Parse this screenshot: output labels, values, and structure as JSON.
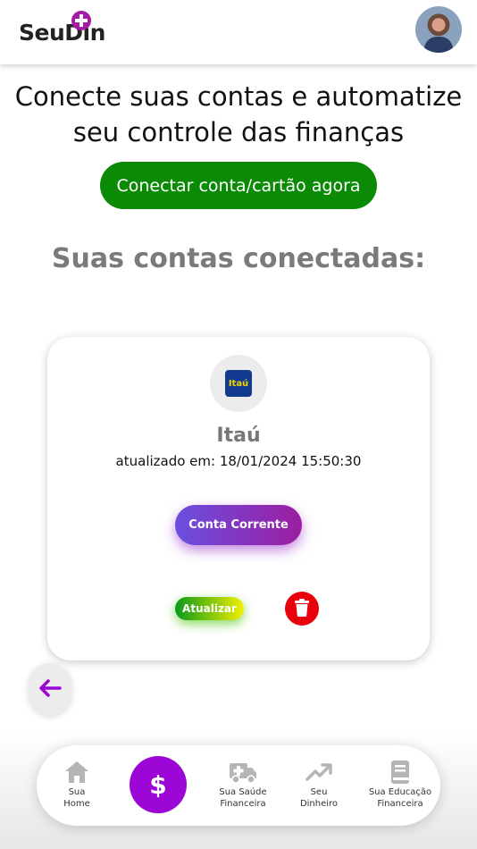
{
  "header": {
    "logo_text": "SeuDin",
    "avatar_icon": "user-avatar-photo"
  },
  "main": {
    "headline_line1": "Conecte suas contas e automatize",
    "headline_line2": "seu controle das finanças",
    "connect_button": "Conectar conta/cartão agora",
    "section_title": "Suas contas conectadas:"
  },
  "account_card": {
    "bank_logo_text": "Itaú",
    "bank_name": "Itaú",
    "updated_label": "atualizado em: 18/01/2024 15:50:30",
    "account_type_button": "Conta Corrente",
    "update_button": "Atualizar",
    "delete_icon": "trash-icon"
  },
  "bottom_nav": {
    "items": [
      {
        "label": "Sua\nHome",
        "icon": "home-icon"
      },
      {
        "label": "$",
        "icon": "dollar-icon"
      },
      {
        "label": "Sua Saúde\nFinanceira",
        "icon": "ambulance-icon"
      },
      {
        "label": "Seu\nDinheiro",
        "icon": "trending-up-icon"
      },
      {
        "label": "Sua Educação\nFinanceira",
        "icon": "book-icon"
      }
    ]
  },
  "colors": {
    "brand_purple": "#9b06d6",
    "connect_green": "#0b8a06",
    "delete_red": "#e8000b"
  }
}
